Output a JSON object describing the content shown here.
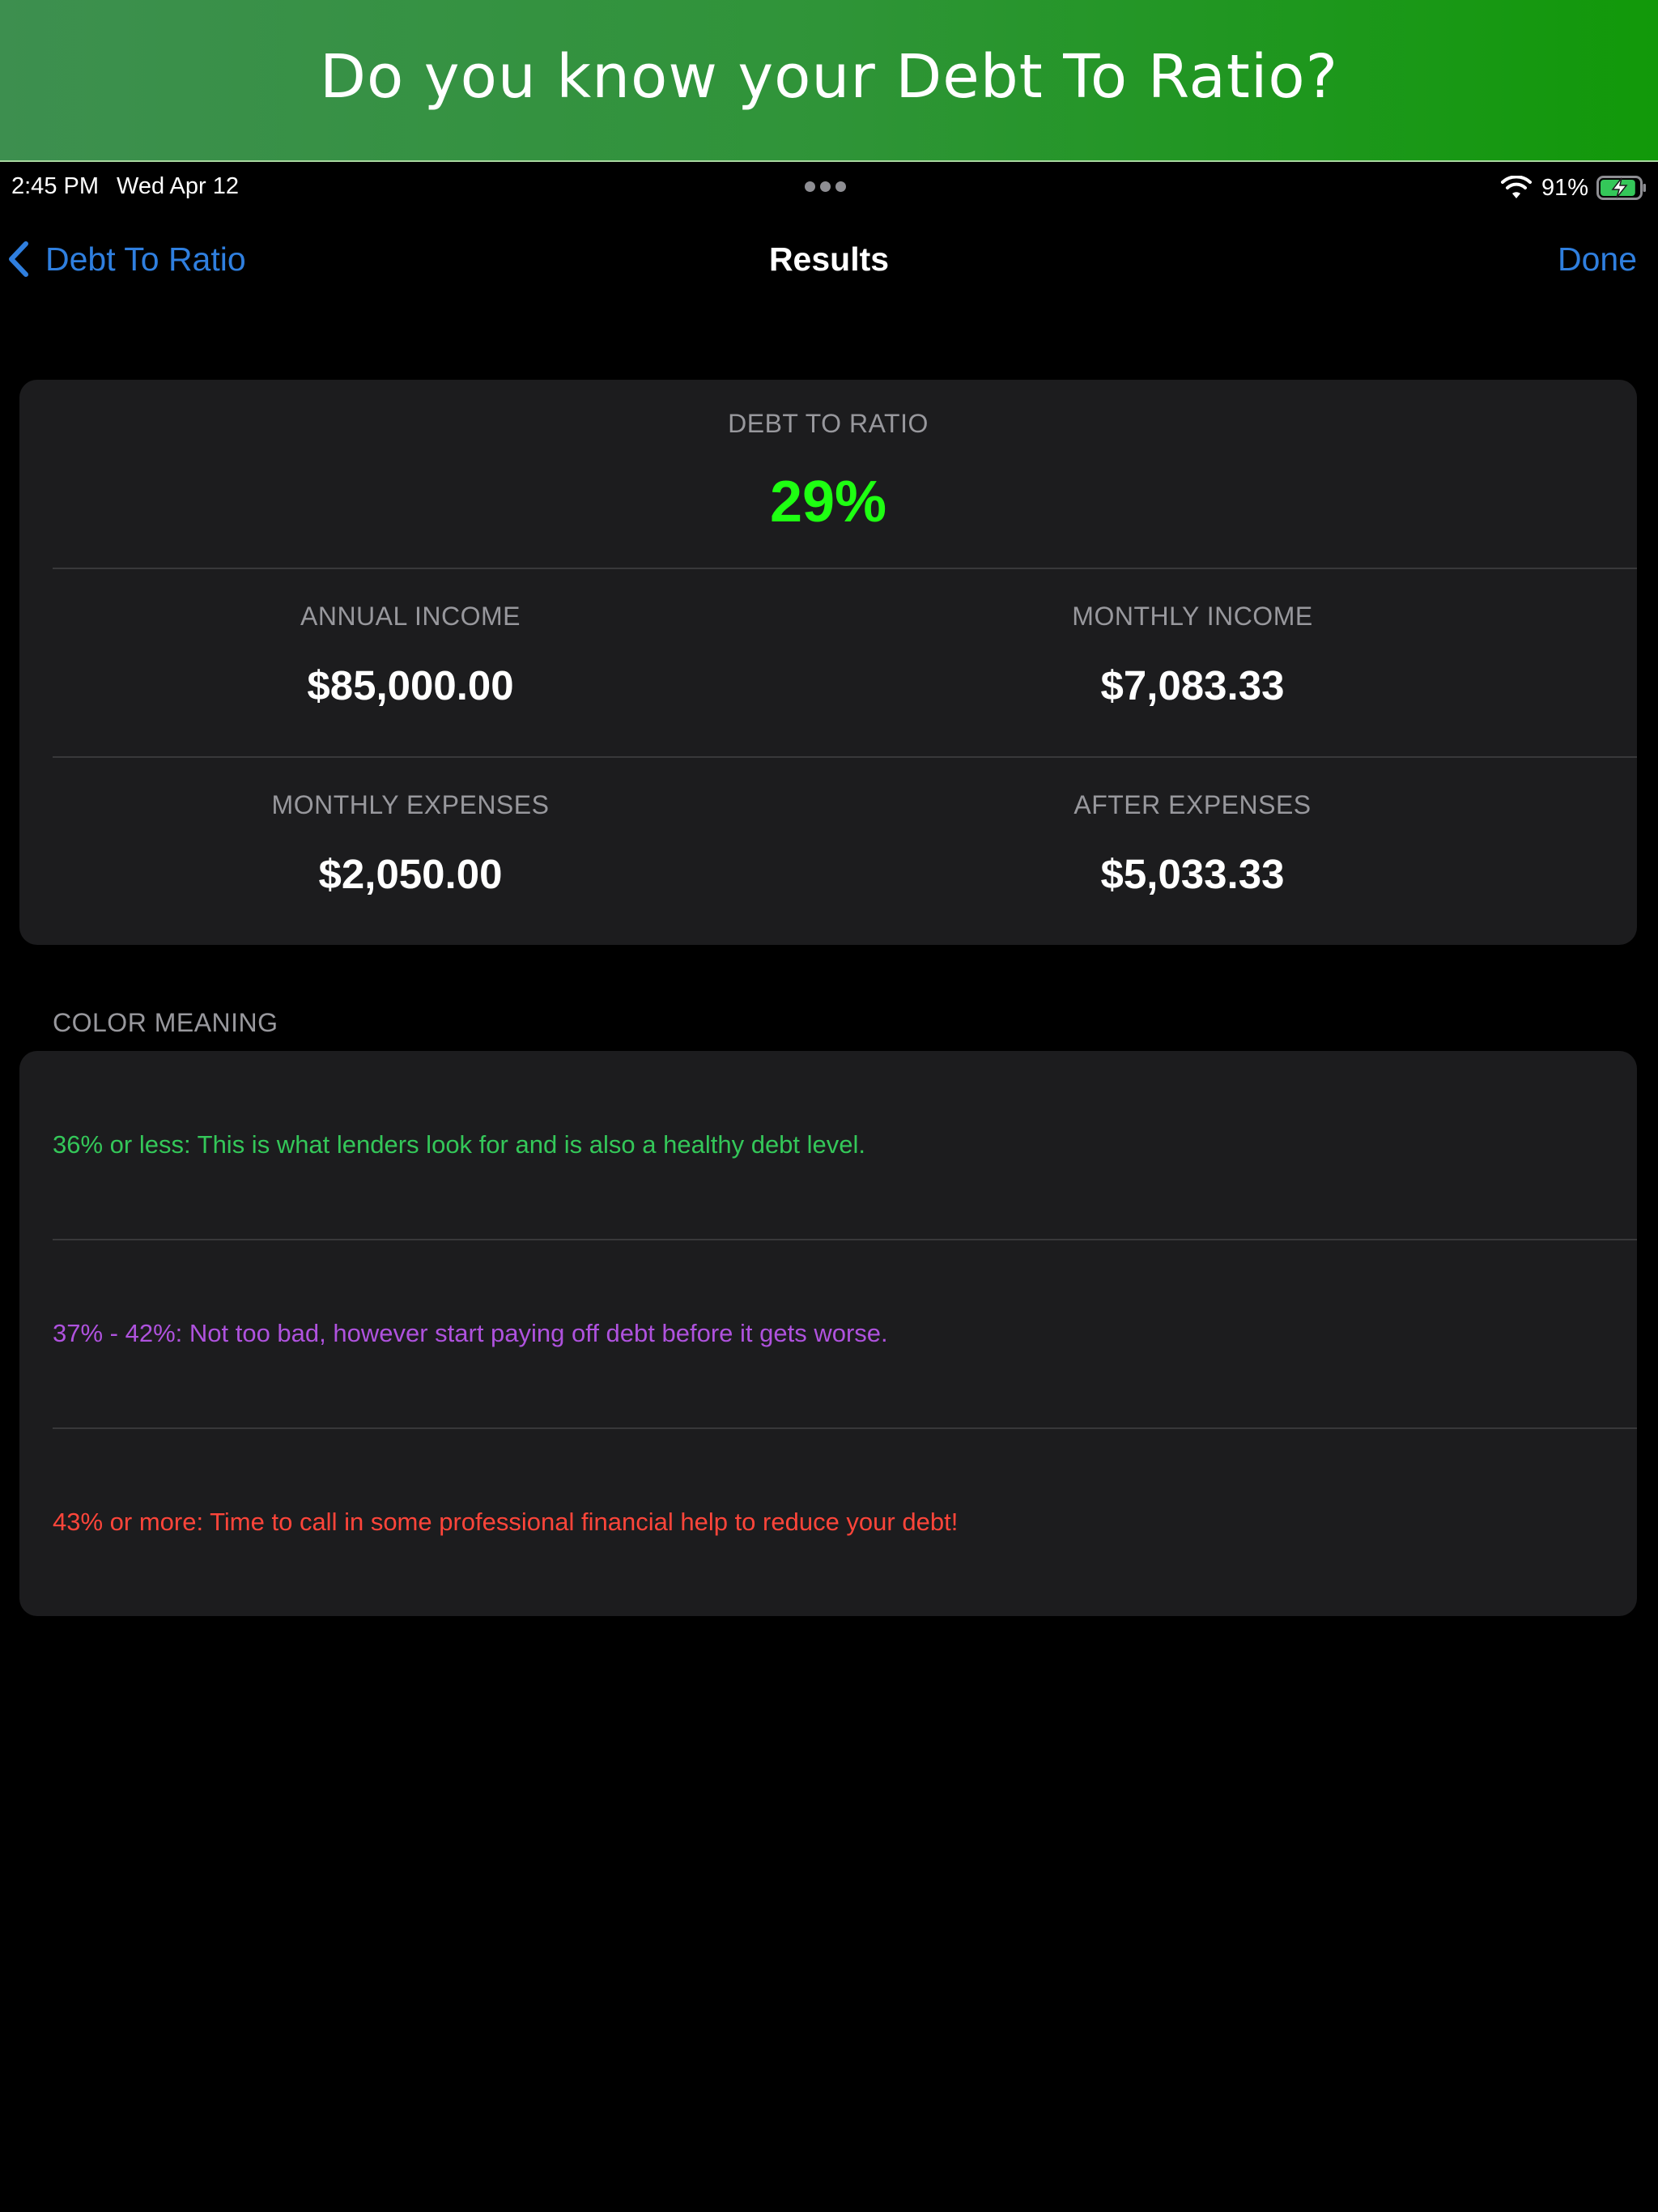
{
  "banner": {
    "title": "Do you know your Debt To Ratio?"
  },
  "status_bar": {
    "time": "2:45 PM",
    "date": "Wed Apr 12",
    "battery_percent": "91%",
    "battery_level": 0.91,
    "charging": true
  },
  "nav": {
    "back_label": "Debt To Ratio",
    "title": "Results",
    "done_label": "Done",
    "accent_color": "#2f7fdf"
  },
  "results": {
    "ratio_label": "DEBT TO RATIO",
    "ratio_value": "29%",
    "ratio_color": "#1eff12",
    "annual_income_label": "ANNUAL INCOME",
    "annual_income_value": "$85,000.00",
    "monthly_income_label": "MONTHLY INCOME",
    "monthly_income_value": "$7,083.33",
    "monthly_expenses_label": "MONTHLY EXPENSES",
    "monthly_expenses_value": "$2,050.00",
    "after_expenses_label": "AFTER EXPENSES",
    "after_expenses_value": "$5,033.33"
  },
  "color_meaning": {
    "header": "COLOR MEANING",
    "items": [
      {
        "text": "36% or less: This is what lenders look for and is also a healthy debt level.",
        "color": "#34c759"
      },
      {
        "text": "37% - 42%: Not too bad, however start paying off debt before it gets worse.",
        "color": "#af52de"
      },
      {
        "text": "43% or more: Time to call in some professional financial help to reduce your debt!",
        "color": "#ff453a"
      }
    ]
  }
}
